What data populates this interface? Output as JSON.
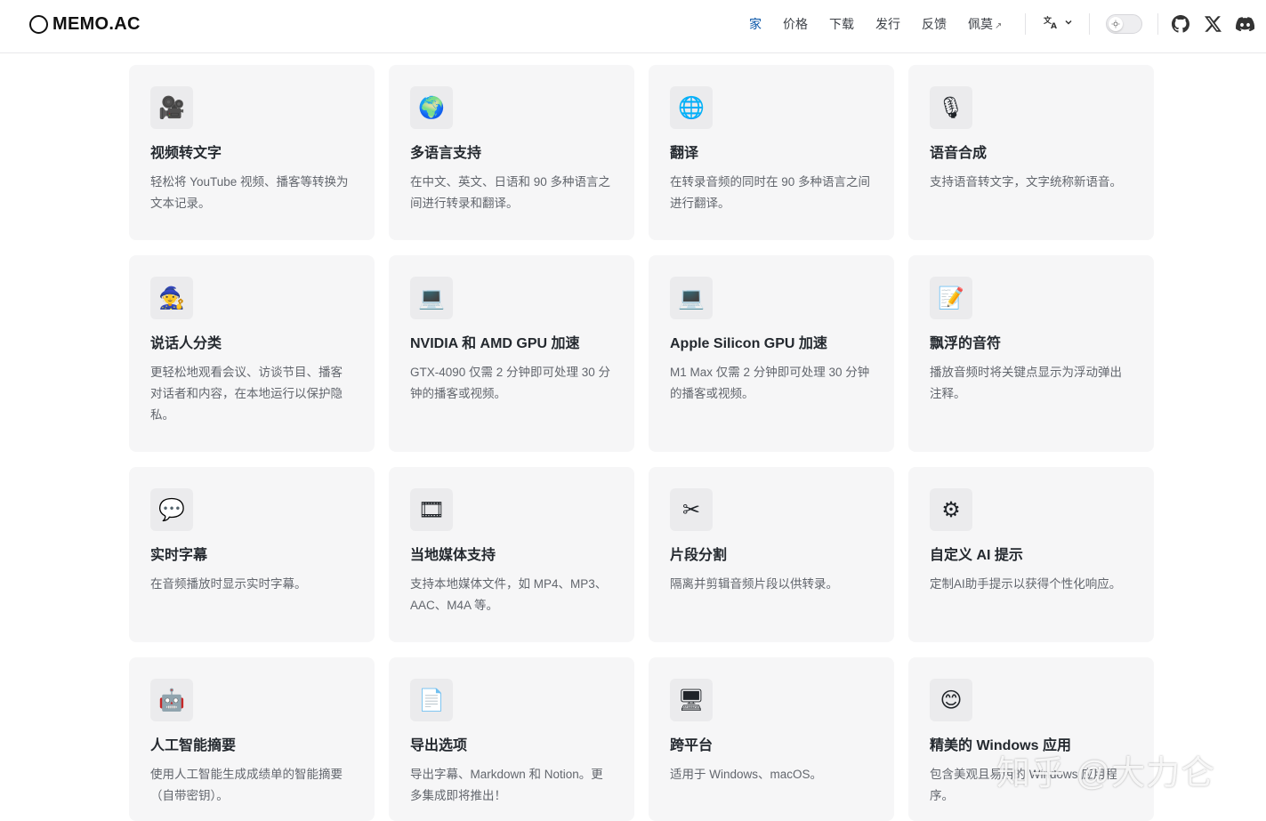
{
  "brand": {
    "name": "MEMO.AC"
  },
  "nav": {
    "items": [
      "家",
      "价格",
      "下载",
      "发行",
      "反馈",
      "佩莫"
    ],
    "external_marker": "↗"
  },
  "lang": {
    "icon": "translate-icon",
    "glyph": "文A"
  },
  "theme_toggle": {
    "icon": "sun-icon"
  },
  "social": [
    "github-icon",
    "x-icon",
    "discord-icon"
  ],
  "cards": [
    {
      "icon": "movie-camera-icon",
      "glyph": "🎥",
      "title": "视频转文字",
      "desc": "轻松将 YouTube 视频、播客等转换为文本记录。"
    },
    {
      "icon": "globe-icon",
      "glyph": "🌍",
      "title": "多语言支持",
      "desc": "在中文、英文、日语和 90 多种语言之间进行转录和翻译。"
    },
    {
      "icon": "globe-meridians-icon",
      "glyph": "🌐",
      "title": "翻译",
      "desc": "在转录音频的同时在 90 多种语言之间进行翻译。"
    },
    {
      "icon": "microphone-icon",
      "glyph": "🎙",
      "title": "语音合成",
      "desc": "支持语音转文字，文字统称新语音。"
    },
    {
      "icon": "speaker-diarization-icon",
      "glyph": "🧙",
      "title": "说话人分类",
      "desc": "更轻松地观看会议、访谈节目、播客对话者和内容，在本地运行以保护隐私。"
    },
    {
      "icon": "laptop-icon",
      "glyph": "💻",
      "title": "NVIDIA 和 AMD GPU 加速",
      "desc": "GTX-4090 仅需 2 分钟即可处理 30 分钟的播客或视频。"
    },
    {
      "icon": "laptop-icon",
      "glyph": "💻",
      "title": "Apple Silicon GPU 加速",
      "desc": "M1 Max 仅需 2 分钟即可处理 30 分钟的播客或视频。"
    },
    {
      "icon": "memo-icon",
      "glyph": "📝",
      "title": "飘浮的音符",
      "desc": "播放音频时将关键点显示为浮动弹出注释。"
    },
    {
      "icon": "speech-bubble-icon",
      "glyph": "💬",
      "title": "实时字幕",
      "desc": "在音频播放时显示实时字幕。"
    },
    {
      "icon": "film-icon",
      "glyph": "🎞",
      "title": "当地媒体支持",
      "desc": "支持本地媒体文件，如 MP4、MP3、AAC、M4A 等。"
    },
    {
      "icon": "scissors-icon",
      "glyph": "✂",
      "title": "片段分割",
      "desc": "隔离并剪辑音频片段以供转录。"
    },
    {
      "icon": "gear-icon",
      "glyph": "⚙",
      "title": "自定义 AI 提示",
      "desc": "定制AI助手提示以获得个性化响应。"
    },
    {
      "icon": "robot-icon",
      "glyph": "🤖",
      "title": "人工智能摘要",
      "desc": "使用人工智能生成成绩单的智能摘要（自带密钥）。"
    },
    {
      "icon": "document-icon",
      "glyph": "📄",
      "title": "导出选项",
      "desc": "导出字幕、Markdown 和 Notion。更多集成即将推出！"
    },
    {
      "icon": "desktop-icon",
      "glyph": "🖥",
      "title": "跨平台",
      "desc": "适用于 Windows、macOS。"
    },
    {
      "icon": "smiley-icon",
      "glyph": "😊",
      "title": "精美的 Windows 应用",
      "desc": "包含美观且易用的 Windows 应用程序。"
    }
  ],
  "watermark": "知乎 @大力仑"
}
